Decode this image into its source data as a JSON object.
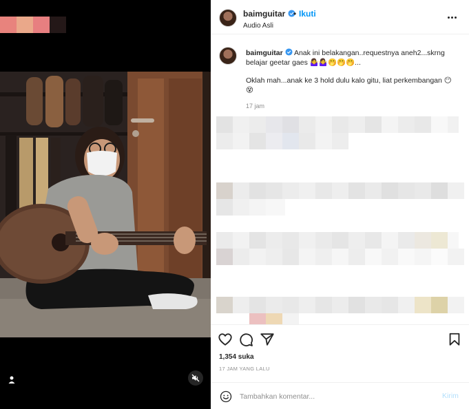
{
  "post": {
    "username": "baimguitar",
    "dot": "•",
    "follow_label": "Ikuti",
    "audio_label": "Audio Asli"
  },
  "caption": {
    "username": "baimguitar",
    "text": "Anak ini belakangan..requestnya aneh2...skrng belajar geetar gaes 🤷‍♀️🤷‍♀️🤭🤭🤭...",
    "reply": "Oklah mah...anak ke 3 hold dulu kalo gitu, liat perkembangan 😶😵",
    "time": "17 jam"
  },
  "actions": {
    "likes": "1,354 suka",
    "posted_ago": "17 JAM YANG LALU"
  },
  "comment_box": {
    "placeholder": "Tambahkan komentar...",
    "send_label": "Kirim"
  },
  "icons": {
    "like": "heart-icon",
    "comment": "comment-icon",
    "share": "paper-plane-icon",
    "save": "bookmark-icon",
    "more": "more-horizontal-icon",
    "emoji": "emoji-icon",
    "mute": "speaker-muted-icon",
    "tag": "user-tag-icon"
  },
  "colors": {
    "link": "#0095f6",
    "send_disabled": "#b2dffc",
    "verified": "#3897f0"
  }
}
